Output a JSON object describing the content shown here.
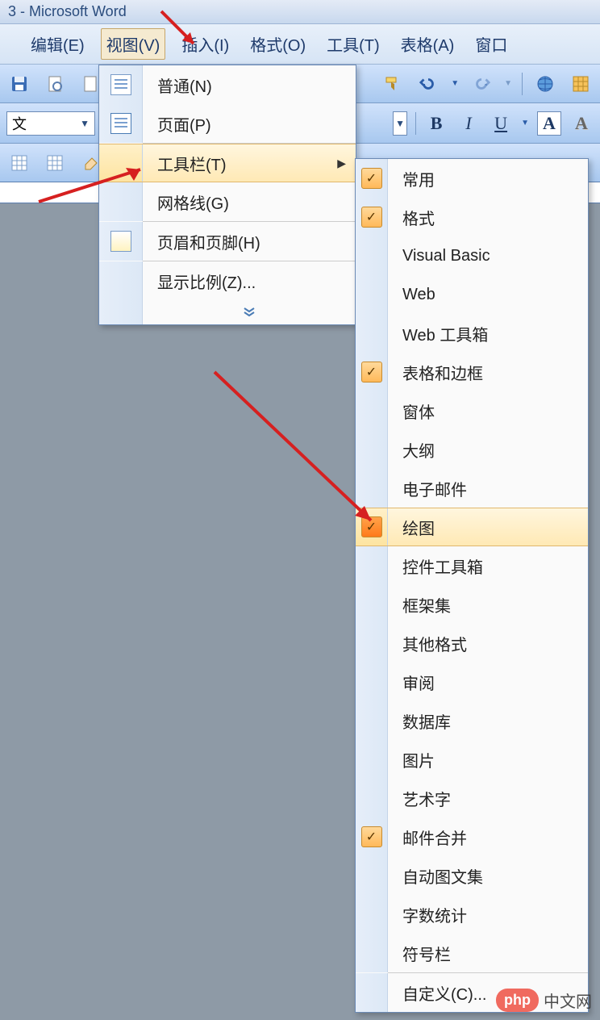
{
  "app_title": "3 - Microsoft Word",
  "menubar": {
    "edit": "编辑(E)",
    "view": "视图(V)",
    "insert": "插入(I)",
    "format": "格式(O)",
    "tools": "工具(T)",
    "table": "表格(A)",
    "window": "窗口"
  },
  "toolbar2": {
    "style_text": "文",
    "bold": "B",
    "italic": "I",
    "underline": "U",
    "font_grow": "A",
    "font_shadow": "A"
  },
  "view_menu": {
    "normal": "普通(N)",
    "page": "页面(P)",
    "toolbar": "工具栏(T)",
    "gridlines": "网格线(G)",
    "header_footer": "页眉和页脚(H)",
    "zoom": "显示比例(Z)..."
  },
  "toolbar_submenu": [
    {
      "label": "常用",
      "checked": true
    },
    {
      "label": "格式",
      "checked": true
    },
    {
      "label": "Visual Basic",
      "checked": false
    },
    {
      "label": "Web",
      "checked": false
    },
    {
      "label": "Web 工具箱",
      "checked": false
    },
    {
      "label": "表格和边框",
      "checked": true
    },
    {
      "label": "窗体",
      "checked": false
    },
    {
      "label": "大纲",
      "checked": false
    },
    {
      "label": "电子邮件",
      "checked": false
    },
    {
      "label": "绘图",
      "checked": true,
      "highlighted": true
    },
    {
      "label": "控件工具箱",
      "checked": false
    },
    {
      "label": "框架集",
      "checked": false
    },
    {
      "label": "其他格式",
      "checked": false
    },
    {
      "label": "审阅",
      "checked": false
    },
    {
      "label": "数据库",
      "checked": false
    },
    {
      "label": "图片",
      "checked": false
    },
    {
      "label": "艺术字",
      "checked": false
    },
    {
      "label": "邮件合并",
      "checked": true
    },
    {
      "label": "自动图文集",
      "checked": false
    },
    {
      "label": "字数统计",
      "checked": false
    },
    {
      "label": "符号栏",
      "checked": false
    },
    {
      "label": "自定义(C)...",
      "checked": false
    }
  ],
  "watermark": {
    "logo": "php",
    "text": "中文网"
  }
}
